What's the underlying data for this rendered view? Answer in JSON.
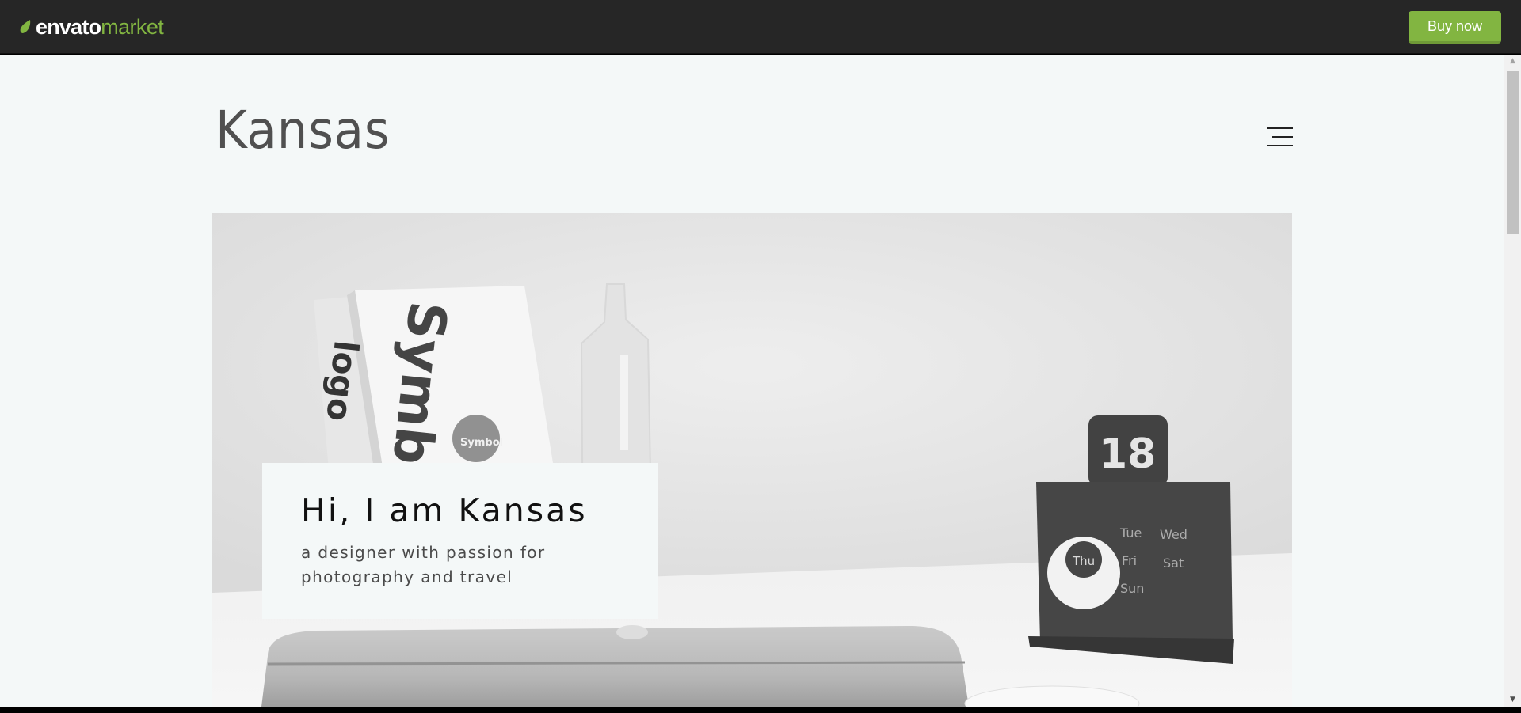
{
  "envato_bar": {
    "logo": {
      "icon": "leaf-icon",
      "word1": "envato",
      "word2": "market"
    },
    "buy_button": "Buy now",
    "colors": {
      "bar": "#262626",
      "accent": "#82b541"
    }
  },
  "site": {
    "title": "Kansas",
    "menu_icon": "hamburger-menu-icon"
  },
  "hero": {
    "image": "grayscale-desk-photo",
    "card": {
      "title": "Hi, I am Kansas",
      "subtitle": "a designer with passion for photography and travel"
    },
    "photo_text": {
      "book_spine_1": "Symb",
      "book_spine_2": "logo",
      "sticker": "Symbol",
      "calendar_number": "18",
      "day_thu": "Thu",
      "day_tue": "Tue",
      "day_wed": "Wed",
      "day_fri": "Fri",
      "day_sat": "Sat",
      "day_sun": "Sun"
    }
  },
  "scrollbar": {
    "up_icon": "scroll-up-arrow-icon",
    "down_icon": "scroll-down-arrow-icon"
  }
}
